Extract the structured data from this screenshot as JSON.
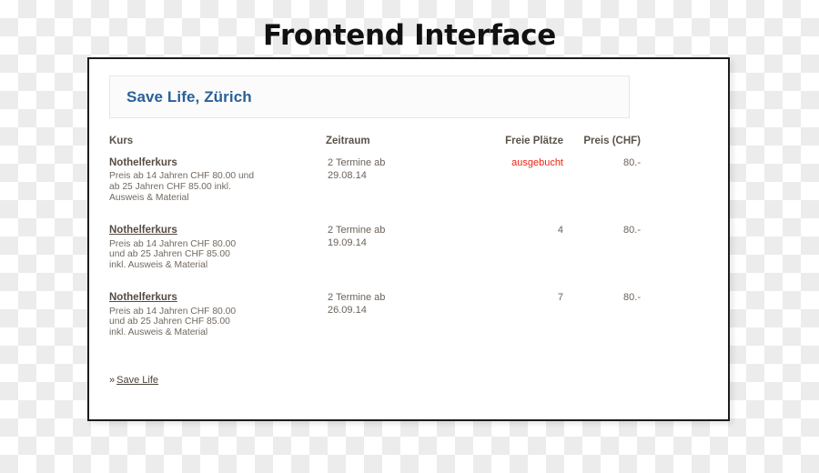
{
  "page": {
    "title": "Frontend Interface"
  },
  "site_header": {
    "title": "Save Life, Zürich"
  },
  "table": {
    "columns": {
      "kurs": "Kurs",
      "zeitraum": "Zeitraum",
      "freie_plaetze": "Freie Plätze",
      "preis": "Preis (CHF)"
    },
    "rows": [
      {
        "name": "Nothelferkurs",
        "is_link": false,
        "desc_line1": "Preis ab 14 Jahren CHF 80.00 und",
        "desc_line2": "ab 25 Jahren CHF 85.00 inkl.",
        "desc_line3": "Ausweis & Material",
        "zeitraum_line1": "2 Termine ab",
        "zeitraum_line2": "29.08.14",
        "freie_plaetze": "ausgebucht",
        "sold_out": true,
        "preis": "80.-"
      },
      {
        "name": "Nothelferkurs",
        "is_link": true,
        "desc_line1": "Preis ab 14 Jahren CHF 80.00",
        "desc_line2": "und ab 25 Jahren CHF 85.00",
        "desc_line3": "inkl. Ausweis & Material",
        "zeitraum_line1": "2 Termine ab",
        "zeitraum_line2": "19.09.14",
        "freie_plaetze": "4",
        "sold_out": false,
        "preis": "80.-"
      },
      {
        "name": "Nothelferkurs",
        "is_link": true,
        "desc_line1": "Preis ab 14 Jahren CHF 80.00",
        "desc_line2": "und ab 25 Jahren CHF 85.00",
        "desc_line3": "inkl. Ausweis & Material",
        "zeitraum_line1": "2 Termine ab",
        "zeitraum_line2": "26.09.14",
        "freie_plaetze": "7",
        "sold_out": false,
        "preis": "80.-"
      }
    ]
  },
  "footer": {
    "guillemet": "»",
    "link_label": "Save Life"
  },
  "colors": {
    "brand_blue": "#2a6099",
    "sold_out_red": "#ee2211",
    "text_brown": "#6b625a",
    "frame_border": "#1c1c1c"
  }
}
